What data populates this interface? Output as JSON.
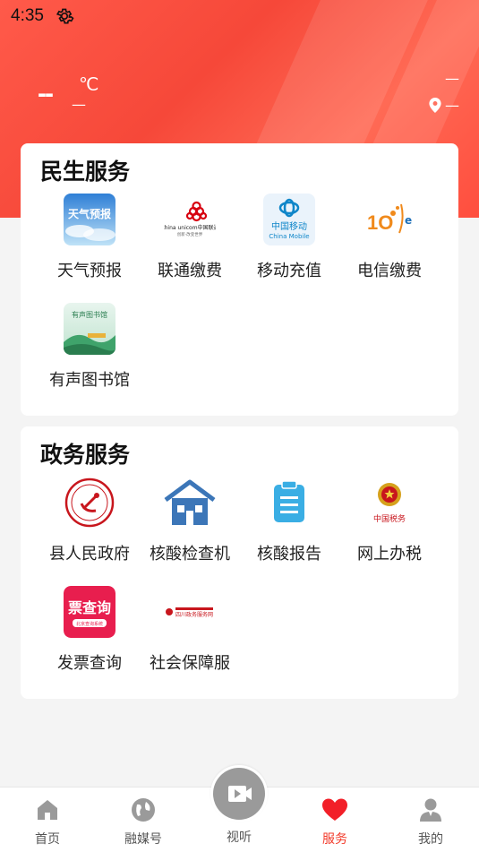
{
  "status_bar": {
    "time": "4:35",
    "settings_icon": "gear-icon"
  },
  "weather": {
    "temperature": "--",
    "unit": "℃",
    "condition": "—",
    "right_value": "—",
    "location": "—",
    "location_icon": "location-pin-icon"
  },
  "sections": [
    {
      "title": "民生服务",
      "items": [
        {
          "label": "天气预报",
          "icon": "weather-forecast-icon"
        },
        {
          "label": "联通缴费",
          "icon": "china-unicom-icon"
        },
        {
          "label": "移动充值",
          "icon": "china-mobile-icon"
        },
        {
          "label": "电信缴费",
          "icon": "china-telecom-icon"
        },
        {
          "label": "有声图书馆",
          "icon": "audio-library-icon"
        }
      ]
    },
    {
      "title": "政务服务",
      "items": [
        {
          "label": "县人民政府",
          "icon": "county-government-icon"
        },
        {
          "label": "核酸检查机",
          "icon": "nucleic-test-station-icon"
        },
        {
          "label": "核酸报告",
          "icon": "nucleic-report-icon"
        },
        {
          "label": "网上办税",
          "icon": "online-tax-icon"
        },
        {
          "label": "发票查询",
          "icon": "invoice-query-icon"
        },
        {
          "label": "社会保障服",
          "icon": "social-security-icon"
        }
      ]
    }
  ],
  "images": {
    "unicom_text": "China unicom中国联通",
    "unicom_sub": "创新·改变世界",
    "mobile_cn": "中国移动",
    "mobile_en": "China Mobile",
    "tax_text": "中国税务",
    "invoice_text": "票查询",
    "invoice_sub": "北京查询系统",
    "social_text": "四川政务服务网",
    "library_text": "有声图书馆",
    "weather_text": "天气预报"
  },
  "tabbar": {
    "tabs": [
      {
        "label": "首页",
        "icon": "home-icon",
        "active": false
      },
      {
        "label": "融媒号",
        "icon": "globe-icon",
        "active": false
      },
      {
        "label": "视听",
        "icon": "video-camera-icon",
        "active": false
      },
      {
        "label": "服务",
        "icon": "heart-icon",
        "active": true
      },
      {
        "label": "我的",
        "icon": "user-icon",
        "active": false
      }
    ]
  },
  "colors": {
    "brand": "#f23a2a",
    "hero": "#f64839",
    "inactive": "#9a9a9a"
  }
}
